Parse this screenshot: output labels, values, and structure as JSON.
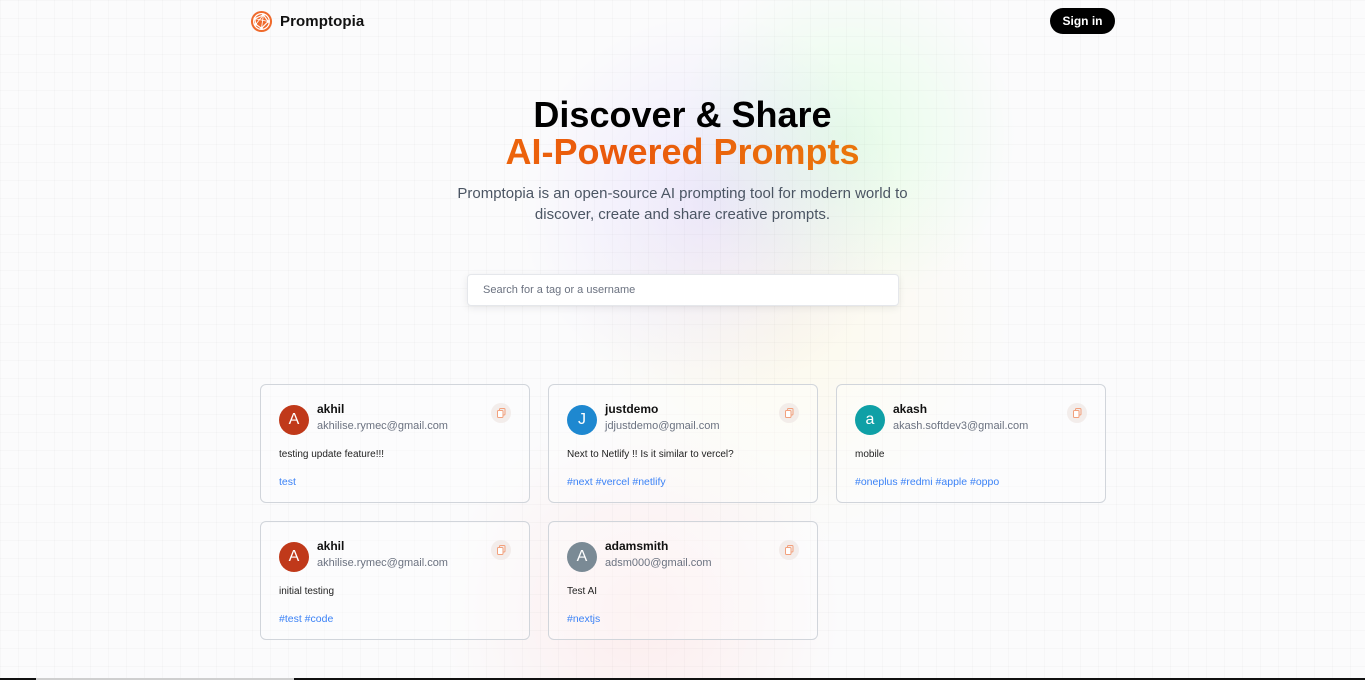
{
  "nav": {
    "brand_name": "Promptopia",
    "brand_icon": "globe-logo-icon",
    "signin_label": "Sign in"
  },
  "hero": {
    "title_line1": "Discover & Share",
    "title_line2": "AI-Powered Prompts",
    "description": "Promptopia is an open-source AI prompting tool for modern world to discover, create and share creative prompts."
  },
  "search": {
    "placeholder": "Search for a tag or a username",
    "value": ""
  },
  "colors": {
    "accent_orange": "#ea580c",
    "tag_blue": "#3b82f6"
  },
  "cards": [
    {
      "initial": "A",
      "avatar_color": "#c0391a",
      "username": "akhil",
      "email": "akhilise.rymec@gmail.com",
      "prompt": "testing update feature!!!",
      "tags": "test"
    },
    {
      "initial": "J",
      "avatar_color": "#1e88d0",
      "username": "justdemo",
      "email": "jdjustdemo@gmail.com",
      "prompt": "Next to Netlify !! Is it similar to vercel?",
      "tags": "#next #vercel #netlify"
    },
    {
      "initial": "a",
      "avatar_color": "#0fa0a6",
      "username": "akash",
      "email": "akash.softdev3@gmail.com",
      "prompt": "mobile",
      "tags": "#oneplus #redmi #apple #oppo"
    },
    {
      "initial": "A",
      "avatar_color": "#c0391a",
      "username": "akhil",
      "email": "akhilise.rymec@gmail.com",
      "prompt": "initial testing",
      "tags": "#test #code"
    },
    {
      "initial": "A",
      "avatar_color": "#7a8a95",
      "username": "adamsmith",
      "email": "adsm000@gmail.com",
      "prompt": "Test AI",
      "tags": "#nextjs"
    }
  ]
}
